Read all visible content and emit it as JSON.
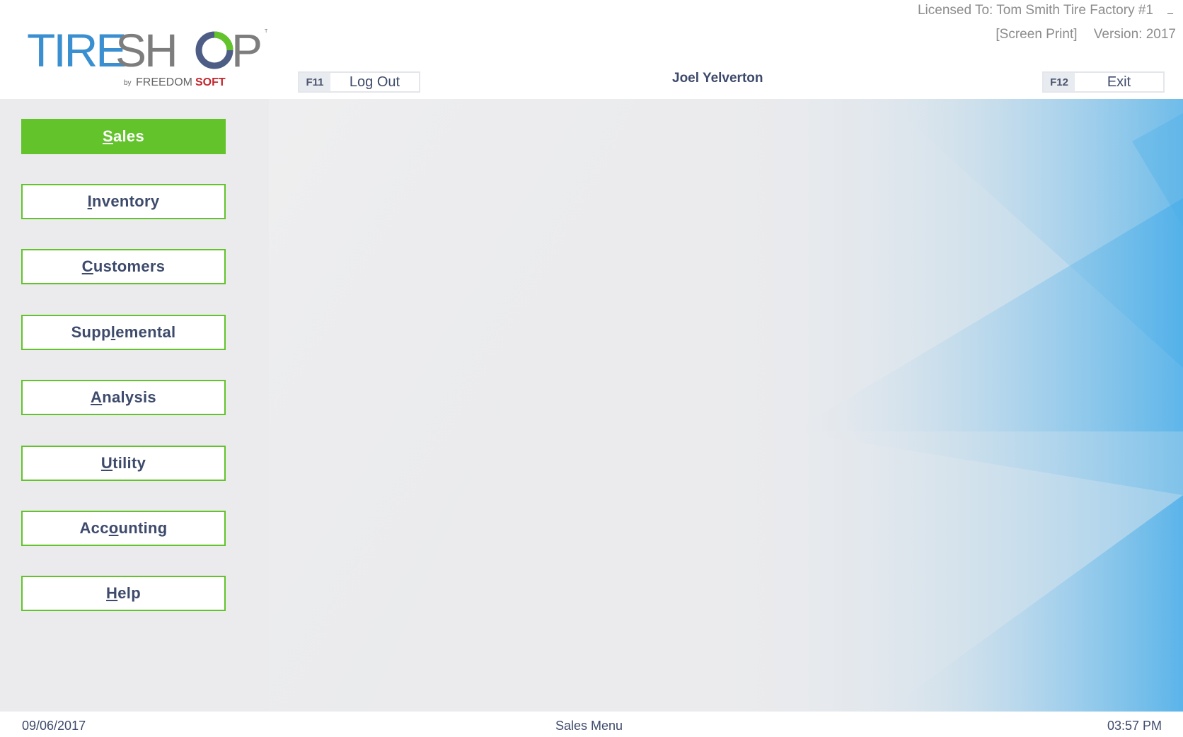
{
  "app": {
    "logo_main": "TIRESHOP",
    "logo_by": "by",
    "logo_company_a": "FREEDOM",
    "logo_company_b": "SOFT",
    "logo_tm": "TM",
    "licensed_to": "Licensed To: Tom Smith Tire Factory #1",
    "screen_print": "[Screen Print]",
    "version": "Version: 2017",
    "minimize_label": "_"
  },
  "header": {
    "user": "Joel Yelverton",
    "logout": {
      "key": "F11",
      "label": "Log Out"
    },
    "exit": {
      "key": "F12",
      "label": "Exit"
    }
  },
  "menu": {
    "items": [
      {
        "pre": "",
        "ul": "S",
        "post": "ales",
        "active": true
      },
      {
        "pre": "",
        "ul": "I",
        "post": "nventory",
        "active": false
      },
      {
        "pre": "",
        "ul": "C",
        "post": "ustomers",
        "active": false
      },
      {
        "pre": "Supp",
        "ul": "l",
        "post": "emental",
        "active": false
      },
      {
        "pre": "",
        "ul": "A",
        "post": "nalysis",
        "active": false
      },
      {
        "pre": "",
        "ul": "U",
        "post": "tility",
        "active": false
      },
      {
        "pre": "Acc",
        "ul": "o",
        "post": "unting",
        "active": false
      },
      {
        "pre": "",
        "ul": "H",
        "post": "elp",
        "active": false
      }
    ]
  },
  "status": {
    "date": "09/06/2017",
    "screen": "Sales Menu",
    "time": "03:57 PM"
  },
  "colors": {
    "accent_green": "#62c32b",
    "text_navy": "#3d4a6b",
    "bg_blue": "#4aaee9",
    "logo_blue": "#3a8fd0",
    "logo_gray": "#7d7d7d",
    "logo_red": "#c4262e"
  }
}
